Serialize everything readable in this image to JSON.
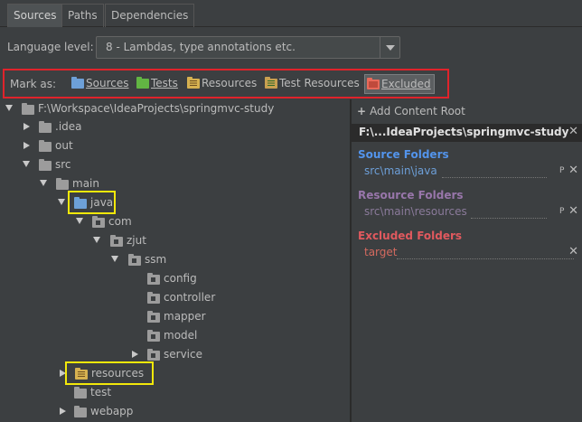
{
  "tabs": [
    {
      "label": "Sources",
      "active": true
    },
    {
      "label": "Paths",
      "active": false
    },
    {
      "label": "Dependencies",
      "active": false
    }
  ],
  "language": {
    "label": "Language level:",
    "value": "8 - Lambdas, type annotations etc."
  },
  "markas": {
    "label": "Mark as:",
    "buttons": [
      {
        "label": "Sources",
        "icon": "sources-folder-icon",
        "color": "#6da0d8"
      },
      {
        "label": "Tests",
        "icon": "tests-folder-icon",
        "color": "#62b543"
      },
      {
        "label": "Resources",
        "icon": "resources-folder-icon",
        "color": "#d6b150"
      },
      {
        "label": "Test Resources",
        "icon": "test-resources-folder-icon",
        "color": "#c8a050"
      },
      {
        "label": "Excluded",
        "icon": "excluded-folder-icon",
        "color": "#e86a5a",
        "active": true
      }
    ]
  },
  "tree": [
    {
      "label": "F:\\Workspace\\IdeaProjects\\springmvc-study",
      "level": 0,
      "expanded": true,
      "icon": "folder-icon"
    },
    {
      "label": ".idea",
      "level": 1,
      "expanded": false,
      "icon": "folder-icon"
    },
    {
      "label": "out",
      "level": 1,
      "expanded": false,
      "icon": "folder-icon"
    },
    {
      "label": "src",
      "level": 1,
      "expanded": true,
      "icon": "folder-icon"
    },
    {
      "label": "main",
      "level": 2,
      "expanded": true,
      "icon": "folder-icon"
    },
    {
      "label": "java",
      "level": 3,
      "expanded": true,
      "icon": "source-folder-icon"
    },
    {
      "label": "com",
      "level": 4,
      "expanded": true,
      "icon": "package-icon"
    },
    {
      "label": "zjut",
      "level": 5,
      "expanded": true,
      "icon": "package-icon"
    },
    {
      "label": "ssm",
      "level": 6,
      "expanded": true,
      "icon": "package-icon"
    },
    {
      "label": "config",
      "level": 7,
      "icon": "package-icon"
    },
    {
      "label": "controller",
      "level": 7,
      "icon": "package-icon"
    },
    {
      "label": "mapper",
      "level": 7,
      "icon": "package-icon"
    },
    {
      "label": "model",
      "level": 7,
      "icon": "package-icon"
    },
    {
      "label": "service",
      "level": 7,
      "expanded": false,
      "icon": "package-icon"
    },
    {
      "label": "resources",
      "level": 3,
      "expanded": false,
      "icon": "resources-folder-icon"
    },
    {
      "label": "test",
      "level": 3,
      "icon": "folder-icon"
    },
    {
      "label": "webapp",
      "level": 3,
      "expanded": false,
      "icon": "folder-icon"
    }
  ],
  "right_panel": {
    "add_content_root": "Add Content Root",
    "root_path": "F:\\...IdeaProjects\\springmvc-study",
    "sections": [
      {
        "title": "Source Folders",
        "color": "#5394ec",
        "item": "src\\main\\java",
        "item_color": "#6d9fd8",
        "prefix": "P"
      },
      {
        "title": "Resource Folders",
        "color": "#9876aa",
        "item": "src\\main\\resources",
        "item_color": "#8a7a9a",
        "prefix": "P"
      },
      {
        "title": "Excluded Folders",
        "color": "#e0595e",
        "item": "target",
        "item_color": "#d46a5f",
        "prefix": ""
      }
    ]
  }
}
